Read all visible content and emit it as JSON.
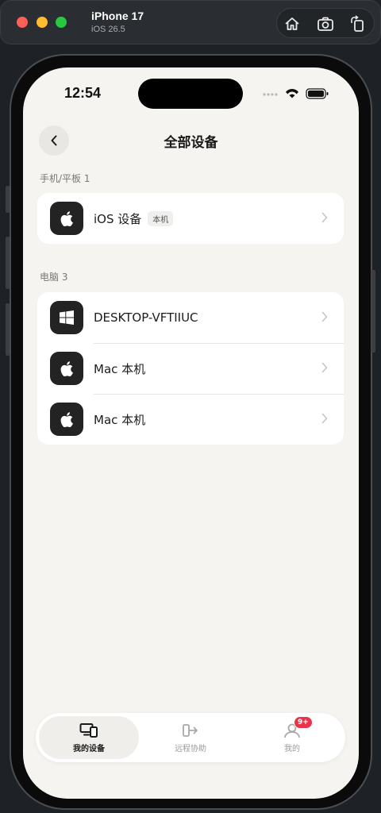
{
  "simulator": {
    "device_name": "iPhone 17",
    "os_version": "iOS 26.5"
  },
  "status_bar": {
    "time": "12:54"
  },
  "nav": {
    "title": "全部设备"
  },
  "sections": [
    {
      "label": "手机/平板 1",
      "devices": [
        {
          "name": "iOS 设备",
          "badge": "本机",
          "icon": "apple-icon"
        }
      ]
    },
    {
      "label": "电脑 3",
      "devices": [
        {
          "name": "DESKTOP-VFTIIUC",
          "icon": "windows-icon"
        },
        {
          "name": "Mac 本机",
          "icon": "apple-icon"
        },
        {
          "name": "Mac 本机",
          "icon": "apple-icon"
        }
      ]
    }
  ],
  "tabbar": {
    "tabs": [
      {
        "label": "我的设备",
        "active": true,
        "icon": "devices-icon"
      },
      {
        "label": "远程协助",
        "active": false,
        "icon": "remote-assist-icon"
      },
      {
        "label": "我的",
        "active": false,
        "icon": "profile-icon",
        "badge": "9+"
      }
    ]
  },
  "colors": {
    "background": "#f5f4f1",
    "card": "#ffffff",
    "icon_tile": "#232323",
    "notification": "#e8344b"
  }
}
